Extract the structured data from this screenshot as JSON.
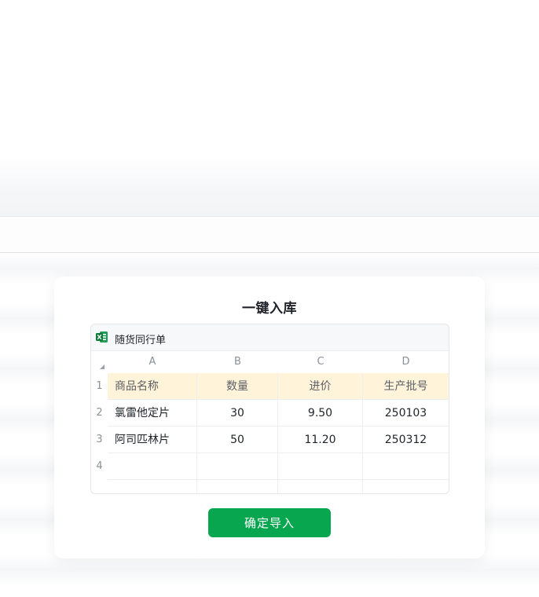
{
  "dialog": {
    "title": "一键入库",
    "confirm_label": "确定导入"
  },
  "sheet": {
    "name": "随货同行单",
    "file_icon": "excel-icon",
    "columns": [
      "A",
      "B",
      "C",
      "D"
    ],
    "row_numbers": [
      "1",
      "2",
      "3",
      "4"
    ],
    "rows": [
      [
        "商品名称",
        "数量",
        "进价",
        "生产批号"
      ],
      [
        "氯雷他定片",
        "30",
        "9.50",
        "250103"
      ],
      [
        "阿司匹林片",
        "50",
        "11.20",
        "250312"
      ],
      [
        "",
        "",
        "",
        ""
      ]
    ]
  },
  "colors": {
    "accent": "#08a74f",
    "header_row": "#fff3d9"
  }
}
